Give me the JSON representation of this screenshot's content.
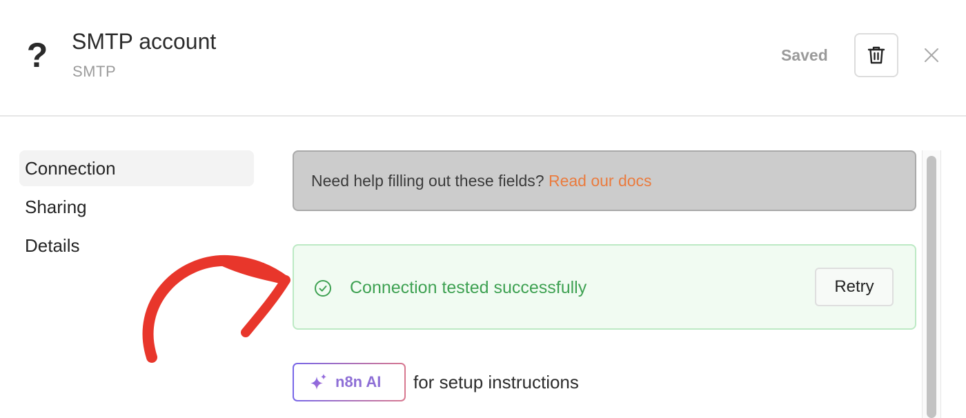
{
  "header": {
    "icon": "question-mark-icon",
    "icon_glyph": "?",
    "title": "SMTP account",
    "subtitle": "SMTP",
    "saved_label": "Saved",
    "delete_icon": "trash-icon",
    "close_icon": "close-icon"
  },
  "sidebar": {
    "items": [
      {
        "label": "Connection",
        "active": true
      },
      {
        "label": "Sharing",
        "active": false
      },
      {
        "label": "Details",
        "active": false
      }
    ]
  },
  "help": {
    "text": "Need help filling out these fields? ",
    "link_text": "Read our docs"
  },
  "status": {
    "icon": "check-circle-icon",
    "message": "Connection tested successfully",
    "retry_label": "Retry"
  },
  "ai": {
    "icon": "sparkle-icon",
    "button_label": "n8n AI",
    "caption": "for setup instructions"
  },
  "annotation": {
    "icon": "red-arrow-icon"
  },
  "colors": {
    "link": "#ea7b3e",
    "success_text": "#3ea152",
    "success_bg": "#f1fbf2",
    "success_border": "#bce9c4",
    "help_bg": "#cccccc",
    "ai_gradient_start": "#7766e8",
    "ai_gradient_end": "#d8788f",
    "annotation_arrow": "#e8362b"
  }
}
